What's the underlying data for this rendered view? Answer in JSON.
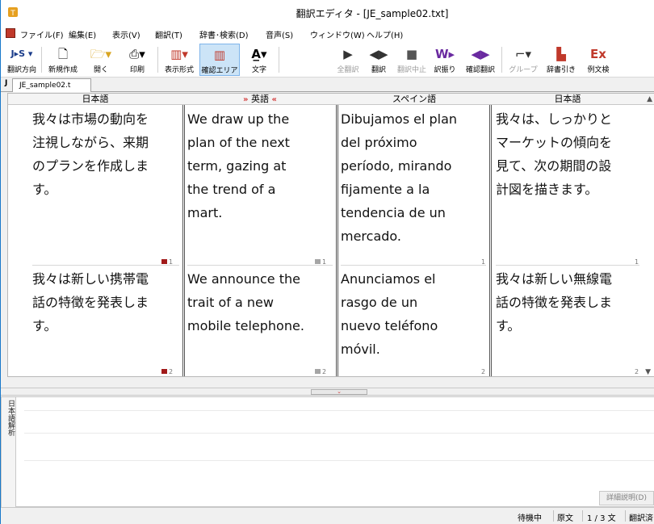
{
  "window": {
    "title": "翻訳エディタ - [JE_sample02.txt]"
  },
  "menu": [
    "ファイル(F)",
    "編集(E)",
    "表示(V)",
    "翻訳(T)",
    "辞書･検索(D)",
    "音声(S)",
    "ウィンドウ(W)",
    "ヘルプ(H)"
  ],
  "toolbar": {
    "direction": "翻訳方向",
    "new": "新規作成",
    "open": "開く",
    "print": "印刷",
    "display_format": "表示形式",
    "confirm_area": "確認エリア",
    "font": "文字",
    "translate_all": "全翻訳",
    "translate": "翻訳",
    "stop": "翻訳中止",
    "reorder": "訳振り",
    "confirm_translate": "確認翻訳",
    "group": "グループ",
    "dict_lookup": "辞書引き",
    "example_search": "例文検"
  },
  "doc_tab": {
    "icon": "J",
    "label": "JE_sample02.t"
  },
  "columns": {
    "h1": "日本語",
    "h2": "英語",
    "h2_left_arrow": "»",
    "h2_right_arrow": "«",
    "h3": "スペイン語",
    "h4": "日本語"
  },
  "rows": [
    {
      "ja": [
        "我々は市場の動向を",
        "注視しながら、来期",
        "のプランを作成しま",
        "す。"
      ],
      "en": [
        "We draw up the",
        "plan of the next",
        "term, gazing at",
        "the trend of a",
        "mart."
      ],
      "es": [
        "Dibujamos el plan",
        "del próximo",
        "período, mirando",
        "fijamente a la",
        "tendencia de un",
        "mercado."
      ],
      "ja2": [
        "我々は、しっかりと",
        "マーケットの傾向を",
        "見て、次の期間の設",
        "計図を描きます。"
      ],
      "m_ja": "1",
      "m_en": "1",
      "m_es": "1",
      "m_ja2": "1"
    },
    {
      "ja": [
        "我々は新しい携帯電",
        "話の特徴を発表しま",
        "す。"
      ],
      "en": [
        "We announce the",
        "trait of a new",
        "mobile telephone."
      ],
      "es": [
        "Anunciamos el",
        "rasgo de un",
        "nuevo teléfono",
        "móvil."
      ],
      "ja2": [
        "我々は新しい無線電",
        "話の特徴を発表しま",
        "す。"
      ],
      "m_ja": "2",
      "m_en": "2",
      "m_es": "2",
      "m_ja2": "2"
    }
  ],
  "analysis": {
    "label": "日本語解析",
    "detail_button": "詳細説明(D)"
  },
  "status": {
    "state": "待機中",
    "mode": "原文",
    "position": "1 / 3 文",
    "translated": "翻訳済"
  }
}
